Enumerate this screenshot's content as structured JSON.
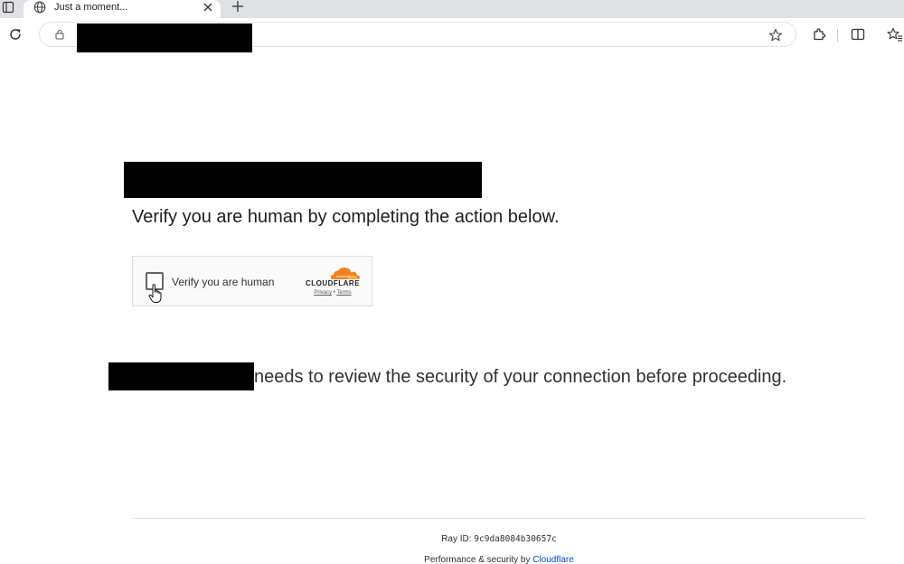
{
  "browser": {
    "tab": {
      "title": "Just a moment...",
      "favicon": "globe-icon"
    },
    "toolbar_icons": [
      "sidebar-toggle-icon",
      "reload-icon",
      "lock-icon",
      "star-icon",
      "extensions-icon",
      "split-screen-icon",
      "favorites-icon",
      "new-tab-icon",
      "close-icon"
    ]
  },
  "page": {
    "heading": "Verify you are human by completing the action below.",
    "widget": {
      "checkbox_label": "Verify you are human",
      "brand": "CLOUDFLARE",
      "privacy_label": "Privacy",
      "separator": "•",
      "terms_label": "Terms"
    },
    "security_message": "needs to review the security of your connection before proceeding.",
    "footer": {
      "ray_label": "Ray ID:",
      "ray_value": "9c9da8084b30657c",
      "perf_prefix": "Performance & security by",
      "perf_link": "Cloudflare"
    }
  },
  "colors": {
    "cloudflare_orange": "#f48120",
    "link_blue": "#0051c3"
  }
}
